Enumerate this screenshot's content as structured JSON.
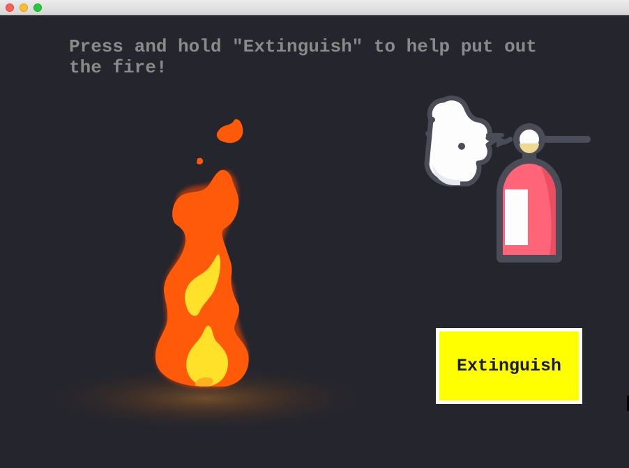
{
  "window": {
    "buttons": [
      "close",
      "minimize",
      "maximize"
    ]
  },
  "instructions": {
    "text": "Press and hold \"Extinguish\" to help put out the fire!"
  },
  "extinguish_button": {
    "label": "Extinguish"
  },
  "icons": {
    "fire": "fire-icon",
    "extinguisher": "fire-extinguisher-icon",
    "smoke": "smoke-cloud-icon"
  },
  "colors": {
    "background": "#25252d",
    "instruction_text": "#8a8a8a",
    "button_fill": "#ffff00",
    "button_border": "#ffffff",
    "flame_outer": "#ff5a0a",
    "flame_inner": "#ffe12a",
    "extinguisher_body": "#ff6478",
    "icon_outline": "#4a4d57"
  }
}
